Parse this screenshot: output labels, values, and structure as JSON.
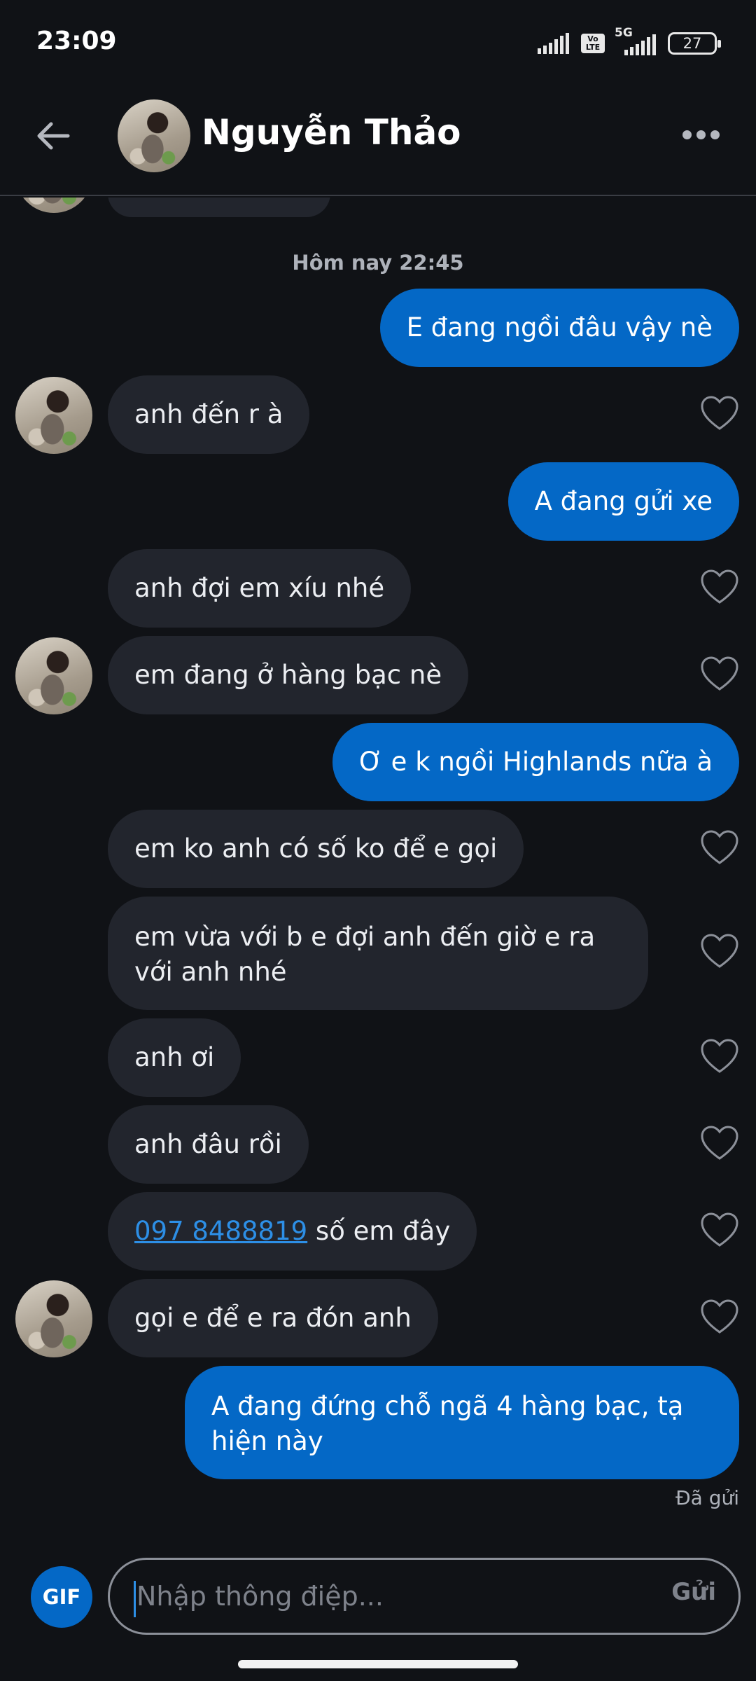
{
  "status_bar": {
    "time": "23:09",
    "network_label": "5G",
    "volte_label": "Vo LTE",
    "battery": "27"
  },
  "header": {
    "name": "Nguyễn Thảo"
  },
  "chat": {
    "date_separator": "Hôm nay 22:45",
    "messages": [
      {
        "direction": "out",
        "text": "E đang ngồi đâu vậy nè"
      },
      {
        "direction": "in",
        "text": "anh đến r à"
      },
      {
        "direction": "out",
        "text": "A đang gửi xe"
      },
      {
        "direction": "in",
        "text": "anh đợi em xíu nhé"
      },
      {
        "direction": "in",
        "text": "em đang ở hàng bạc nè"
      },
      {
        "direction": "out",
        "text": "Ơ e k ngồi Highlands nữa à"
      },
      {
        "direction": "in",
        "text": "em ko anh có số ko để e gọi"
      },
      {
        "direction": "in",
        "text": "em vừa với b e đợi anh đến giờ e ra với anh nhé"
      },
      {
        "direction": "in",
        "text": "anh ơi"
      },
      {
        "direction": "in",
        "text": "anh đâu rồi"
      },
      {
        "direction": "in",
        "phone": "097 8488819",
        "text": " số em đây"
      },
      {
        "direction": "in",
        "text": "gọi e để e ra đón anh"
      },
      {
        "direction": "out",
        "text": "A đang đứng chỗ ngã 4 hàng bạc, tạ hiện này"
      }
    ],
    "sent_status": "Đã gửi"
  },
  "composer": {
    "gif_label": "GIF",
    "placeholder": "Nhập thông điệp...",
    "send_label": "Gửi"
  },
  "colors": {
    "background": "#101216",
    "incoming_bubble": "#22252d",
    "outgoing_bubble": "#0468c6",
    "link": "#2d8fe6"
  }
}
